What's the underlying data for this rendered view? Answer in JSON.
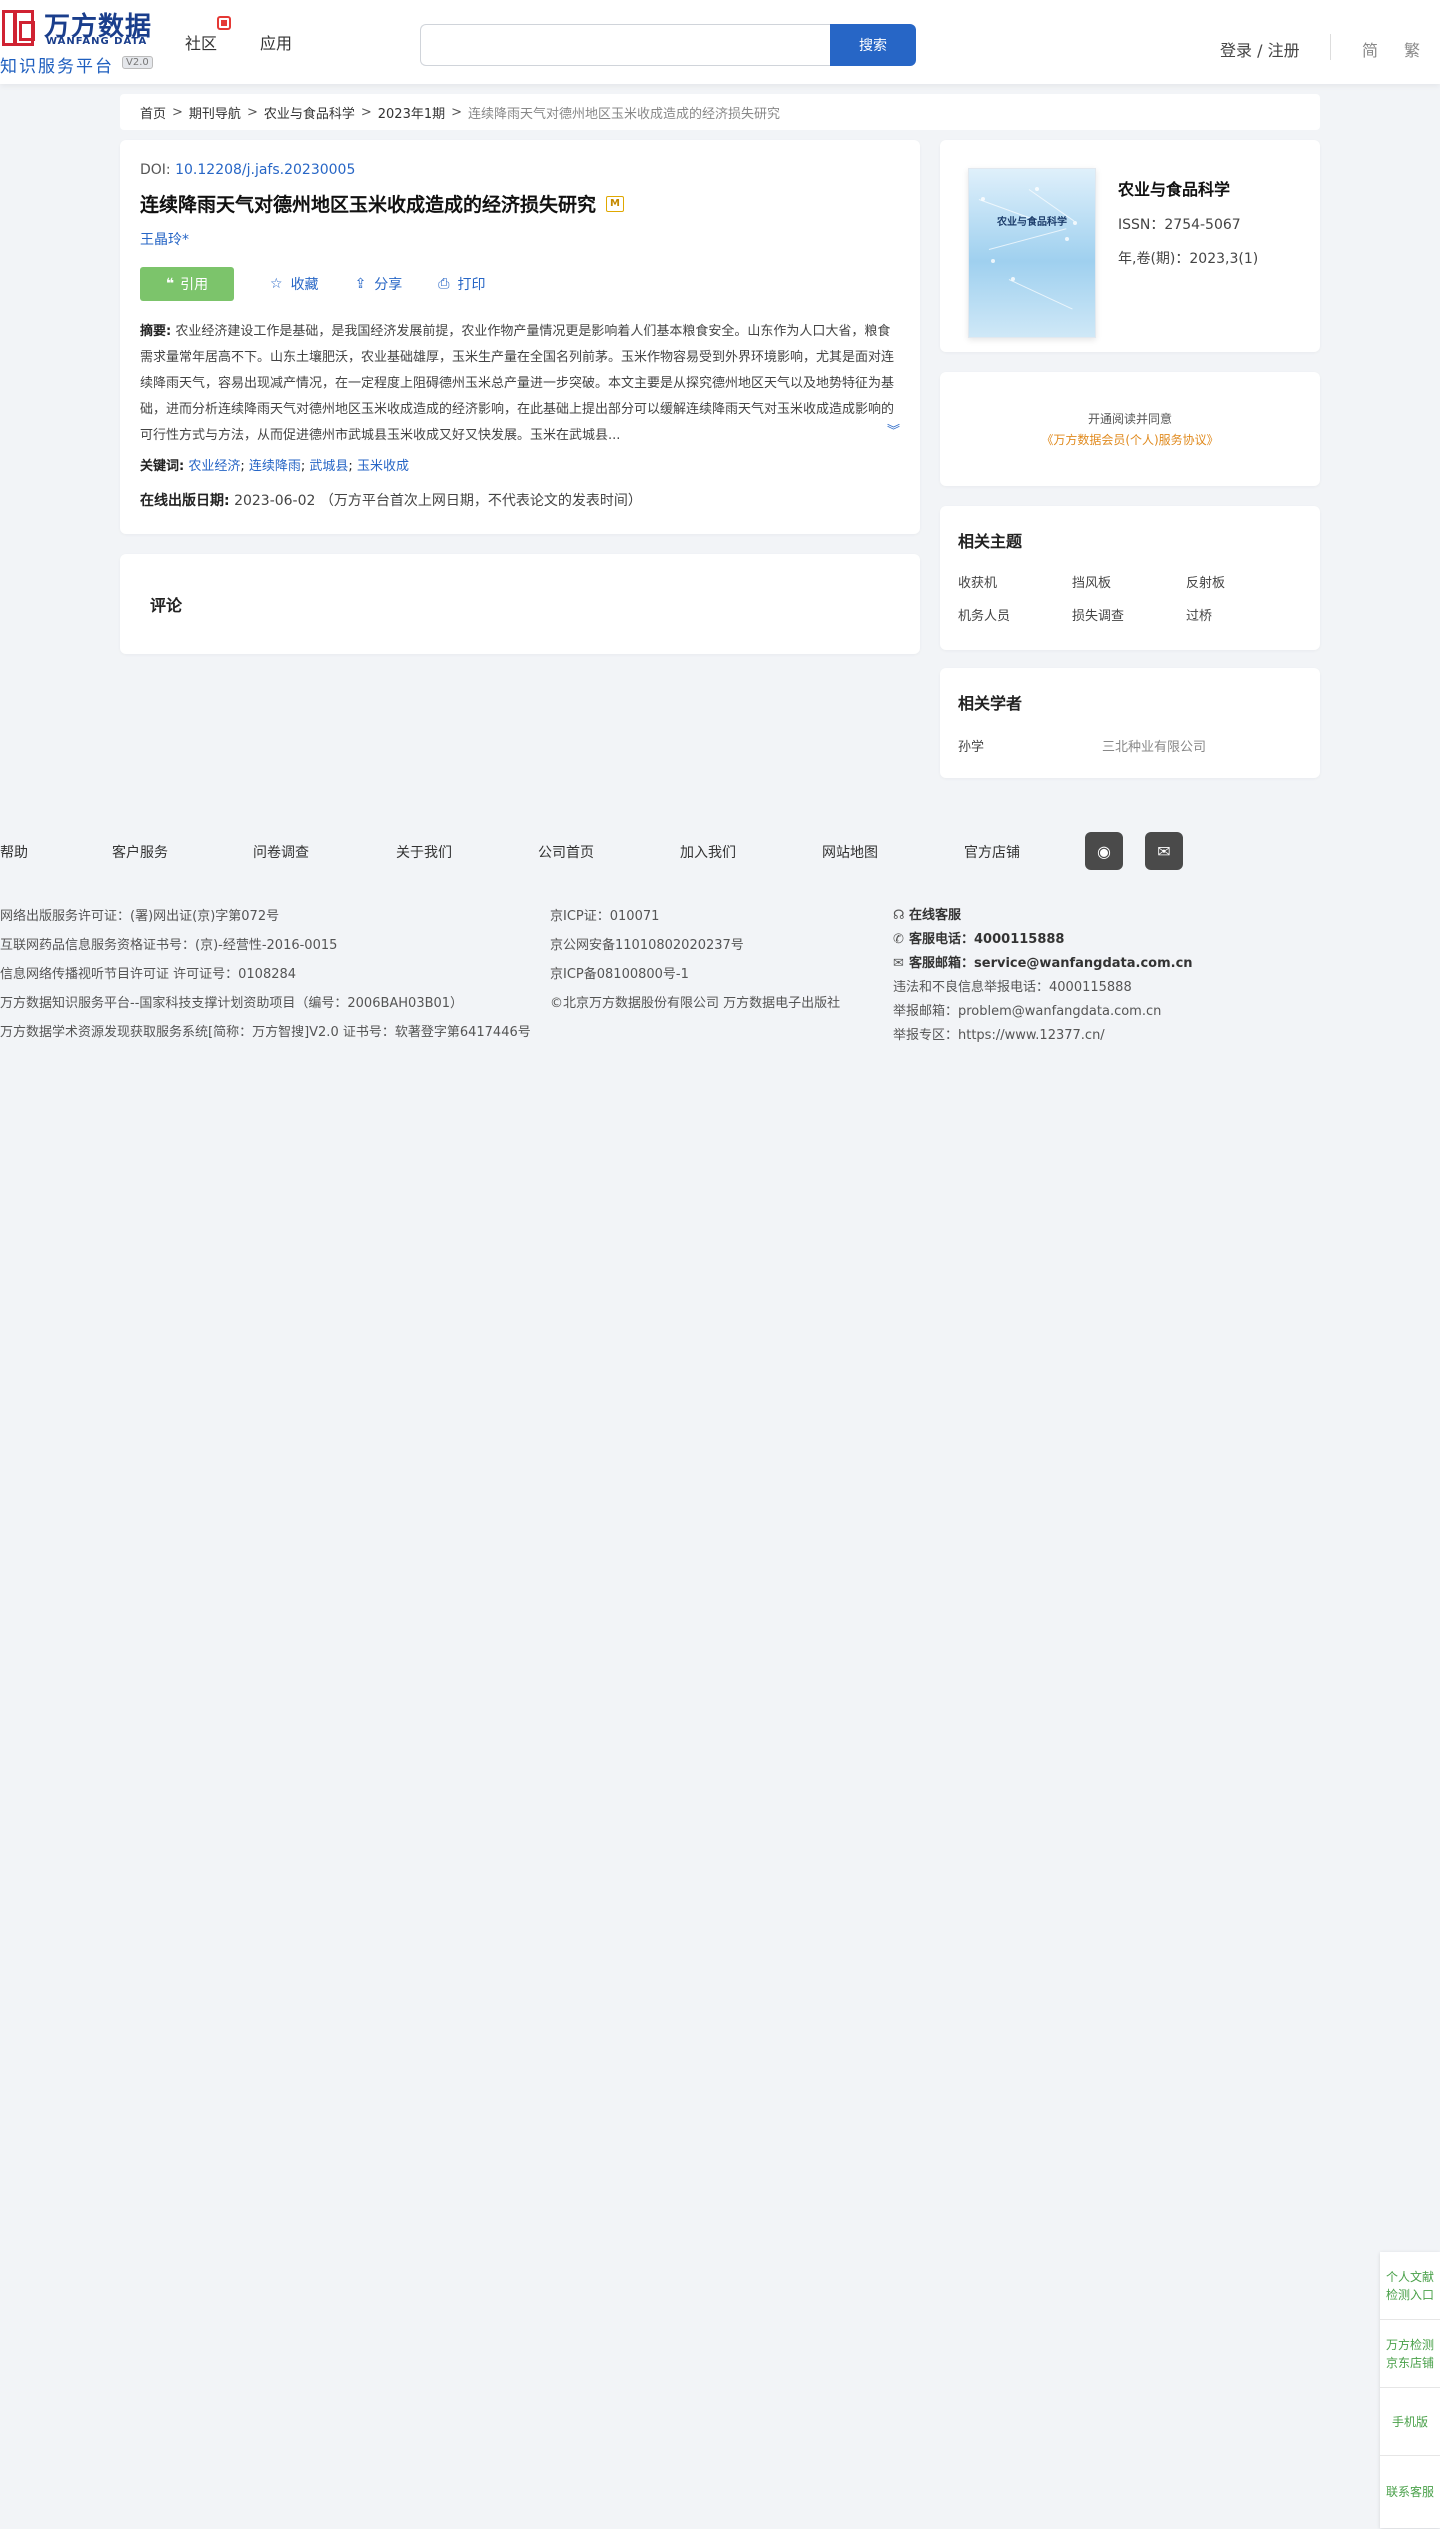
{
  "header": {
    "logo_cn": "万方数据",
    "logo_en": "WANFANG DATA",
    "logo_sub": "知识服务平台",
    "logo_ver": "V2.0",
    "nav": [
      {
        "label": "社区"
      },
      {
        "label": "应用"
      }
    ],
    "search": {
      "value": "",
      "placeholder": "",
      "button": "搜索"
    },
    "login": "登录 / 注册",
    "lang_simplified": "简",
    "lang_traditional": "繁"
  },
  "breadcrumb": {
    "items": [
      "首页",
      "期刊导航",
      "农业与食品科学",
      "2023年1期"
    ],
    "separator": ">",
    "current": "连续降雨天气对德州地区玉米收成造成的经济损失研究"
  },
  "article": {
    "doi_label": "DOI:",
    "doi": "10.12208/j.jafs.20230005",
    "title": "连续降雨天气对德州地区玉米收成造成的经济损失研究",
    "title_badge": "M",
    "author": "王晶玲*",
    "actions": {
      "cite": "引用",
      "favorite": "收藏",
      "share": "分享",
      "print": "打印"
    },
    "abstract_label": "摘要:",
    "abstract": "农业经济建设工作是基础，是我国经济发展前提，农业作物产量情况更是影响着人们基本粮食安全。山东作为人口大省，粮食需求量常年居高不下。山东土壤肥沃，农业基础雄厚，玉米生产量在全国名列前茅。玉米作物容易受到外界环境影响，尤其是面对连续降雨天气，容易出现减产情况，在一定程度上阻碍德州玉米总产量进一步突破。本文主要是从探究德州地区天气以及地势特征为基础，进而分析连续降雨天气对德州地区玉米收成造成的经济影响，在此基础上提出部分可以缓解连续降雨天气对玉米收成造成影响的可行性方式与方法，从而促进德州市武城县玉米收成又好又快发展。玉米在武城县...",
    "keywords_label": "关键词:",
    "keywords": [
      "农业经济",
      "连续降雨",
      "武城县",
      "玉米收成"
    ],
    "pubdate_label": "在线出版日期:",
    "pubdate": "2023-06-02",
    "pubdate_note": "（万方平台首次上网日期，不代表论文的发表时间）"
  },
  "comment": {
    "title": "评论"
  },
  "journal": {
    "cover_title": "农业与食品科学",
    "name": "农业与食品科学",
    "issn": "ISSN：2754-5067",
    "volume": "年,卷(期)：2023,3(1)"
  },
  "promo": {
    "line1": "开通阅读并同意",
    "line2": "《万方数据会员(个人)服务协议》"
  },
  "topics": {
    "title": "相关主题",
    "items": [
      "收获机",
      "挡风板",
      "反射板",
      "机务人员",
      "损失调查",
      "过桥"
    ]
  },
  "scholars": {
    "title": "相关学者",
    "rows": [
      {
        "name": "孙学",
        "org": "三北种业有限公司"
      }
    ]
  },
  "footer": {
    "links": [
      "帮助",
      "客户服务",
      "问卷调查",
      "关于我们",
      "公司首页",
      "加入我们",
      "网站地图",
      "官方店铺"
    ],
    "col1": [
      "网络出版服务许可证：(署)网出证(京)字第072号",
      "互联网药品信息服务资格证书号：(京)-经营性-2016-0015",
      "信息网络传播视听节目许可证 许可证号：0108284",
      "万方数据知识服务平台--国家科技支撑计划资助项目（编号：2006BAH03B01）",
      "万方数据学术资源发现获取服务系统[简称：万方智搜]V2.0 证书号：软著登字第6417446号"
    ],
    "col2": [
      "京ICP证：010071",
      "京公网安备11010802020237号",
      "京ICP备08100800号-1",
      "©北京万方数据股份有限公司 万方数据电子出版社"
    ],
    "online_service": "在线客服",
    "phone_label": "客服电话：",
    "phone": "4000115888",
    "email_label": "客服邮箱：",
    "email": "service@wanfangdata.com.cn",
    "report_phone": "违法和不良信息举报电话：4000115888",
    "report_email": "举报邮箱：problem@wanfangdata.com.cn",
    "report_zone": "举报专区：https://www.12377.cn/"
  },
  "float_bar": [
    "个人文献检测入口",
    "万方检测京东店铺",
    "手机版",
    "联系客服"
  ]
}
